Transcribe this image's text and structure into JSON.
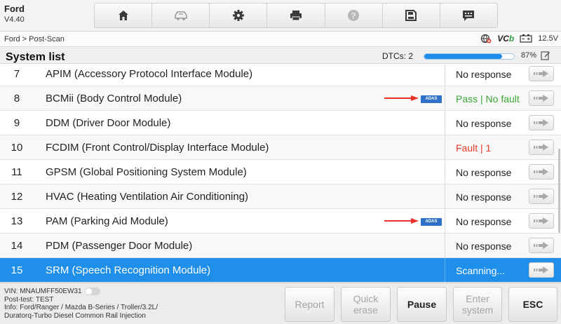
{
  "app": {
    "name": "Ford",
    "version": "V4.40"
  },
  "toolbar": {
    "buttons": [
      {
        "icon": "home-icon"
      },
      {
        "icon": "vehicle-swap-icon"
      },
      {
        "icon": "settings-gear-icon"
      },
      {
        "icon": "printer-icon"
      },
      {
        "icon": "help-icon"
      },
      {
        "icon": "save-icon"
      },
      {
        "icon": "message-icon"
      }
    ]
  },
  "breadcrumb": "Ford > Post-Scan",
  "status_bar": {
    "vci_label": "VC",
    "vci_suffix": "b",
    "battery": "12.5V"
  },
  "list_header": {
    "title": "System list",
    "dtcs_label": "DTCs: 2",
    "progress_percent": 87,
    "progress_label": "87%"
  },
  "rows": [
    {
      "num": "7",
      "name": "APIM (Accessory Protocol Interface Module)",
      "status": "No response",
      "status_kind": "normal",
      "adas": false
    },
    {
      "num": "8",
      "name": "BCMii (Body Control Module)",
      "status": "Pass | No fault",
      "status_kind": "pass",
      "adas": true
    },
    {
      "num": "9",
      "name": "DDM (Driver Door Module)",
      "status": "No response",
      "status_kind": "normal",
      "adas": false
    },
    {
      "num": "10",
      "name": "FCDIM (Front Control/Display Interface Module)",
      "status": "Fault | 1",
      "status_kind": "fault",
      "adas": false
    },
    {
      "num": "11",
      "name": "GPSM (Global Positioning System Module)",
      "status": "No response",
      "status_kind": "normal",
      "adas": false
    },
    {
      "num": "12",
      "name": "HVAC (Heating Ventilation Air Conditioning)",
      "status": "No response",
      "status_kind": "normal",
      "adas": false
    },
    {
      "num": "13",
      "name": "PAM (Parking Aid Module)",
      "status": "No response",
      "status_kind": "normal",
      "adas": true
    },
    {
      "num": "14",
      "name": "PDM (Passenger Door Module)",
      "status": "No response",
      "status_kind": "normal",
      "adas": false
    },
    {
      "num": "15",
      "name": "SRM (Speech Recognition Module)",
      "status": "Scanning...",
      "status_kind": "selected",
      "adas": false
    }
  ],
  "adas_badge": "ADAS",
  "footer": {
    "vin": "VIN: MNAUMFF50EW31",
    "post_test": "Post-test: TEST",
    "info_line1": "Info: Ford/Ranger / Mazda B-Series / Troller/3.2L/",
    "info_line2": "Duratorq-Turbo Diesel Common Rail Injection",
    "report": "Report",
    "quick_erase_1": "Quick",
    "quick_erase_2": "erase",
    "pause": "Pause",
    "enter_system_1": "Enter",
    "enter_system_2": "system",
    "esc": "ESC"
  },
  "colors": {
    "accent": "#1f8fea",
    "pass": "#3aa635",
    "fault": "#e53a2c",
    "adas": "#2f71c6"
  }
}
